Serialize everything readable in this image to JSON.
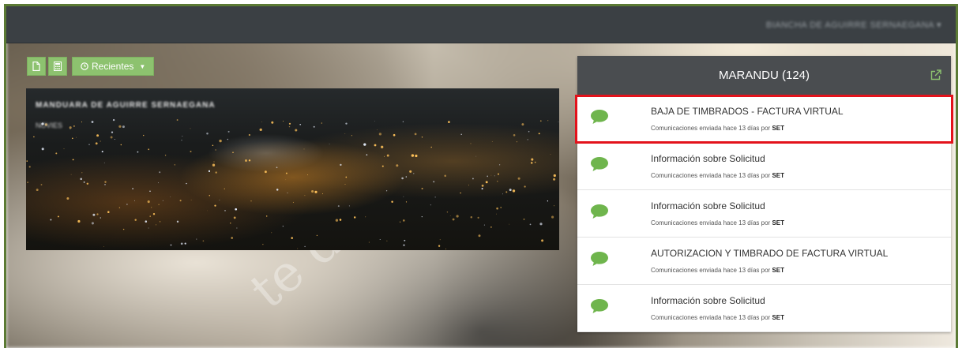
{
  "header": {
    "user_menu": "BIANCHA DE AGUIRRE SERNAEGANA ▾"
  },
  "toolbar": {
    "new_doc_icon": "document-icon",
    "calculator_icon": "calculator-icon",
    "recent_label": "Recientes",
    "recent_icon": "clock-icon"
  },
  "hero": {
    "title": "MANDUARA DE AGUIRRE SERNAEGANA",
    "subtitle": "NOVIES"
  },
  "watermark": "te de",
  "inbox": {
    "title": "MARANDU (124)",
    "external_icon": "external-link-icon",
    "accent_color": "#8dc26f",
    "messages": [
      {
        "subject": "BAJA DE TIMBRADOS - FACTURA VIRTUAL",
        "meta_prefix": "Comunicaciones enviada hace 13 días por",
        "sender": "SET",
        "highlighted": true
      },
      {
        "subject": "Información sobre Solicitud",
        "meta_prefix": "Comunicaciones enviada hace 13 días por",
        "sender": "SET",
        "highlighted": false
      },
      {
        "subject": "Información sobre Solicitud",
        "meta_prefix": "Comunicaciones enviada hace 13 días por",
        "sender": "SET",
        "highlighted": false
      },
      {
        "subject": "AUTORIZACION Y TIMBRADO DE FACTURA VIRTUAL",
        "meta_prefix": "Comunicaciones enviada hace 13 días por",
        "sender": "SET",
        "highlighted": false
      },
      {
        "subject": "Información sobre Solicitud",
        "meta_prefix": "Comunicaciones enviada hace 13 días por",
        "sender": "SET",
        "highlighted": false
      }
    ]
  }
}
